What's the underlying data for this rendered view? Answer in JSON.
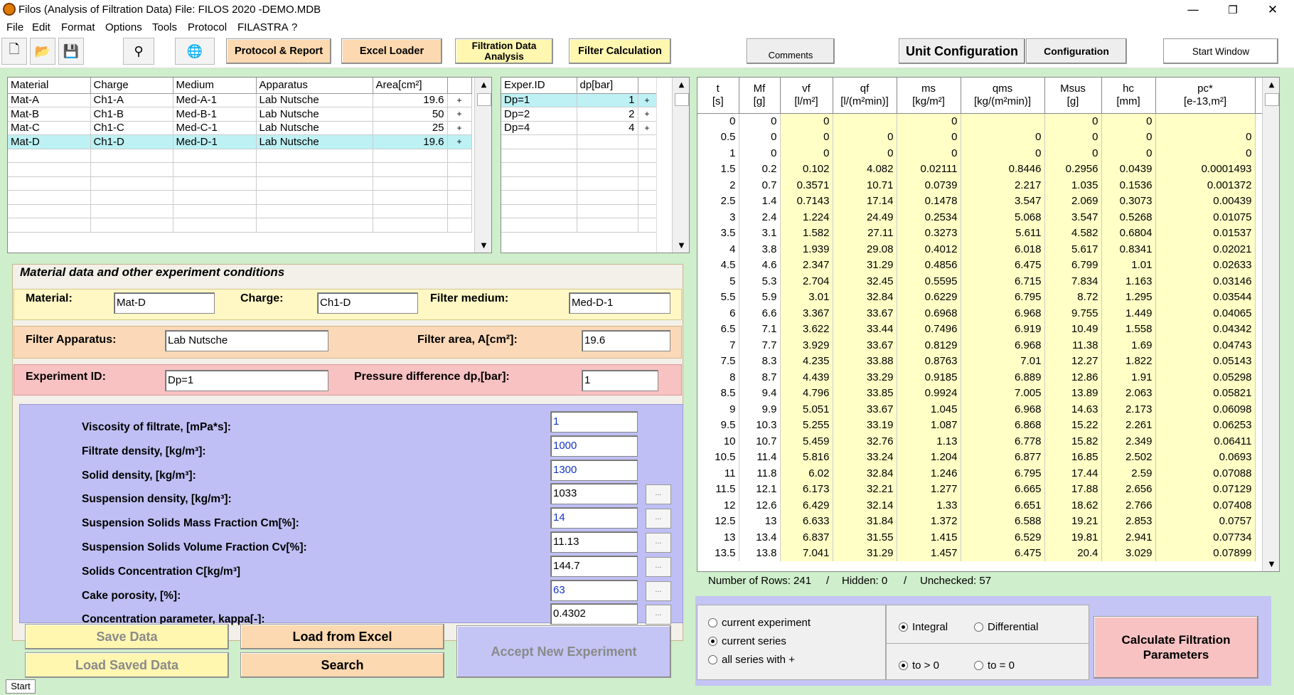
{
  "window": {
    "title": "Filos (Analysis of Filtration Data)   File: FILOS 2020 -DEMO.MDB",
    "min": "—",
    "max": "❐",
    "close": "✕"
  },
  "menu": [
    "File",
    "Edit",
    "Format",
    "Options",
    "Tools",
    "Protocol",
    "FILASTRA",
    "?"
  ],
  "toolbar": {
    "protocol": "Protocol & Report",
    "excel_loader": "Excel Loader",
    "filtration_data_analysis": "Filtration Data Analysis",
    "filter_calculation": "Filter Calculation",
    "comments": "Comments",
    "unit_configuration": "Unit Configuration",
    "configuration": "Configuration",
    "start_window": "Start Window"
  },
  "materials": {
    "headers": [
      "Material",
      "Charge",
      "Medium",
      "Apparatus",
      "Area[cm²]"
    ],
    "rows": [
      [
        "Mat-A",
        "Ch1-A",
        "Med-A-1",
        "Lab Nutsche",
        "19.6",
        "+"
      ],
      [
        "Mat-B",
        "Ch1-B",
        "Med-B-1",
        "Lab  Nutsche",
        "50",
        "+"
      ],
      [
        "Mat-C",
        "Ch1-C",
        "Med-C-1",
        "Lab  Nutsche",
        "25",
        "+"
      ],
      [
        "Mat-D",
        "Ch1-D",
        "Med-D-1",
        "Lab Nutsche",
        "19.6",
        "+"
      ]
    ],
    "selected": 3
  },
  "experiments": {
    "headers": [
      "Exper.ID",
      "dp[bar]"
    ],
    "rows": [
      [
        "Dp=1",
        "1",
        "+"
      ],
      [
        "Dp=2",
        "2",
        "+"
      ],
      [
        "Dp=4",
        "4",
        "+"
      ]
    ],
    "selected": 0
  },
  "material_section": {
    "title": "Material data and  other experiment conditions",
    "material_label": "Material:",
    "material": "Mat-D",
    "charge_label": "Charge:",
    "charge": "Ch1-D",
    "medium_label": "Filter medium:",
    "medium": "Med-D-1",
    "apparatus_label": "Filter Apparatus:",
    "apparatus": "Lab Nutsche",
    "area_label": "Filter area, A[cm²]:",
    "area": "19.6",
    "expid_label": "Experiment ID:",
    "expid": "Dp=1",
    "dp_label": "Pressure difference dp,[bar]:",
    "dp": "1"
  },
  "properties": [
    {
      "label": "Viscosity of filtrate, [mPa*s]:",
      "value": "1",
      "blue": true,
      "btn": false
    },
    {
      "label": "Filtrate density, [kg/m³]:",
      "value": "1000",
      "blue": true,
      "btn": false
    },
    {
      "label": "Solid density, [kg/m³]:",
      "value": "1300",
      "blue": true,
      "btn": false
    },
    {
      "label": "Suspension density, [kg/m³]:",
      "value": "1033",
      "blue": false,
      "btn": true
    },
    {
      "label": "Suspension Solids Mass Fraction Cm[%]:",
      "value": "14",
      "blue": true,
      "btn": true
    },
    {
      "label": "Suspension Solids Volume Fraction Cv[%]:",
      "value": "11.13",
      "blue": false,
      "btn": true
    },
    {
      "label": "Solids Concentration C[kg/m³]",
      "value": "144.7",
      "blue": false,
      "btn": true
    },
    {
      "label": "Cake porosity, [%]:",
      "value": "63",
      "blue": true,
      "btn": true
    },
    {
      "label": "Concentration parameter, kappa[-]:",
      "value": "0.4302",
      "blue": false,
      "btn": true
    }
  ],
  "dot_button": "...",
  "buttons": {
    "save_data": "Save Data",
    "load_saved": "Load Saved Data",
    "load_excel": "Load from Excel",
    "search": "Search",
    "accept": "Accept New Experiment",
    "calculate": "Calculate Filtration Parameters"
  },
  "data_table": {
    "headers": [
      [
        "t",
        "[s]"
      ],
      [
        "Mf",
        "[g]"
      ],
      [
        "vf",
        "[l/m²]"
      ],
      [
        "qf",
        "[l/(m²min)]"
      ],
      [
        "ms",
        "[kg/m²]"
      ],
      [
        "qms",
        "[kg/(m²min)]"
      ],
      [
        "Msus",
        "[g]"
      ],
      [
        "hc",
        "[mm]"
      ],
      [
        "pc*",
        "[e-13,m²]"
      ]
    ],
    "rows": [
      [
        "0",
        "0",
        "0",
        "",
        "0",
        "",
        "0",
        "0",
        "",
        ""
      ],
      [
        "0.5",
        "0",
        "0",
        "0",
        "0",
        "0",
        "0",
        "0",
        "0",
        ""
      ],
      [
        "1",
        "0",
        "0",
        "0",
        "0",
        "0",
        "0",
        "0",
        "0",
        ""
      ],
      [
        "1.5",
        "0.2",
        "0.102",
        "4.082",
        "0.02111",
        "0.8446",
        "0.2956",
        "0.0439",
        "0.0001493",
        ""
      ],
      [
        "2",
        "0.7",
        "0.3571",
        "10.71",
        "0.0739",
        "2.217",
        "1.035",
        "0.1536",
        "0.001372",
        ""
      ],
      [
        "2.5",
        "1.4",
        "0.7143",
        "17.14",
        "0.1478",
        "3.547",
        "2.069",
        "0.3073",
        "0.00439",
        ""
      ],
      [
        "3",
        "2.4",
        "1.224",
        "24.49",
        "0.2534",
        "5.068",
        "3.547",
        "0.5268",
        "0.01075",
        ""
      ],
      [
        "3.5",
        "3.1",
        "1.582",
        "27.11",
        "0.3273",
        "5.611",
        "4.582",
        "0.6804",
        "0.01537",
        ""
      ],
      [
        "4",
        "3.8",
        "1.939",
        "29.08",
        "0.4012",
        "6.018",
        "5.617",
        "0.8341",
        "0.02021",
        "+"
      ],
      [
        "4.5",
        "4.6",
        "2.347",
        "31.29",
        "0.4856",
        "6.475",
        "6.799",
        "1.01",
        "0.02633",
        "+"
      ],
      [
        "5",
        "5.3",
        "2.704",
        "32.45",
        "0.5595",
        "6.715",
        "7.834",
        "1.163",
        "0.03146",
        "+"
      ],
      [
        "5.5",
        "5.9",
        "3.01",
        "32.84",
        "0.6229",
        "6.795",
        "8.72",
        "1.295",
        "0.03544",
        "+"
      ],
      [
        "6",
        "6.6",
        "3.367",
        "33.67",
        "0.6968",
        "6.968",
        "9.755",
        "1.449",
        "0.04065",
        "+"
      ],
      [
        "6.5",
        "7.1",
        "3.622",
        "33.44",
        "0.7496",
        "6.919",
        "10.49",
        "1.558",
        "0.04342",
        "+"
      ],
      [
        "7",
        "7.7",
        "3.929",
        "33.67",
        "0.8129",
        "6.968",
        "11.38",
        "1.69",
        "0.04743",
        "+"
      ],
      [
        "7.5",
        "8.3",
        "4.235",
        "33.88",
        "0.8763",
        "7.01",
        "12.27",
        "1.822",
        "0.05143",
        "+"
      ],
      [
        "8",
        "8.7",
        "4.439",
        "33.29",
        "0.9185",
        "6.889",
        "12.86",
        "1.91",
        "0.05298",
        "+"
      ],
      [
        "8.5",
        "9.4",
        "4.796",
        "33.85",
        "0.9924",
        "7.005",
        "13.89",
        "2.063",
        "0.05821",
        "+"
      ],
      [
        "9",
        "9.9",
        "5.051",
        "33.67",
        "1.045",
        "6.968",
        "14.63",
        "2.173",
        "0.06098",
        "+"
      ],
      [
        "9.5",
        "10.3",
        "5.255",
        "33.19",
        "1.087",
        "6.868",
        "15.22",
        "2.261",
        "0.06253",
        "+"
      ],
      [
        "10",
        "10.7",
        "5.459",
        "32.76",
        "1.13",
        "6.778",
        "15.82",
        "2.349",
        "0.06411",
        "+"
      ],
      [
        "10.5",
        "11.4",
        "5.816",
        "33.24",
        "1.204",
        "6.877",
        "16.85",
        "2.502",
        "0.0693",
        "+"
      ],
      [
        "11",
        "11.8",
        "6.02",
        "32.84",
        "1.246",
        "6.795",
        "17.44",
        "2.59",
        "0.07088",
        "+"
      ],
      [
        "11.5",
        "12.1",
        "6.173",
        "32.21",
        "1.277",
        "6.665",
        "17.88",
        "2.656",
        "0.07129",
        "+"
      ],
      [
        "12",
        "12.6",
        "6.429",
        "32.14",
        "1.33",
        "6.651",
        "18.62",
        "2.766",
        "0.07408",
        "+"
      ],
      [
        "12.5",
        "13",
        "6.633",
        "31.84",
        "1.372",
        "6.588",
        "19.21",
        "2.853",
        "0.0757",
        "+"
      ],
      [
        "13",
        "13.4",
        "6.837",
        "31.55",
        "1.415",
        "6.529",
        "19.81",
        "2.941",
        "0.07734",
        "+"
      ],
      [
        "13.5",
        "13.8",
        "7.041",
        "31.29",
        "1.457",
        "6.475",
        "20.4",
        "3.029",
        "0.07899",
        "+"
      ]
    ]
  },
  "status": {
    "rows": "Number of Rows: 241",
    "sep1": "/",
    "hidden": "Hidden: 0",
    "sep2": "/",
    "unchecked": "Unchecked: 57"
  },
  "options": {
    "scope": [
      {
        "label": "current experiment",
        "on": false
      },
      {
        "label": "current series",
        "on": true
      },
      {
        "label": "all series with +",
        "on": false
      }
    ],
    "integral": "Integral",
    "differential": "Differential",
    "to_gt": "to > 0",
    "to_eq": "to = 0"
  },
  "start_tab": "Start"
}
